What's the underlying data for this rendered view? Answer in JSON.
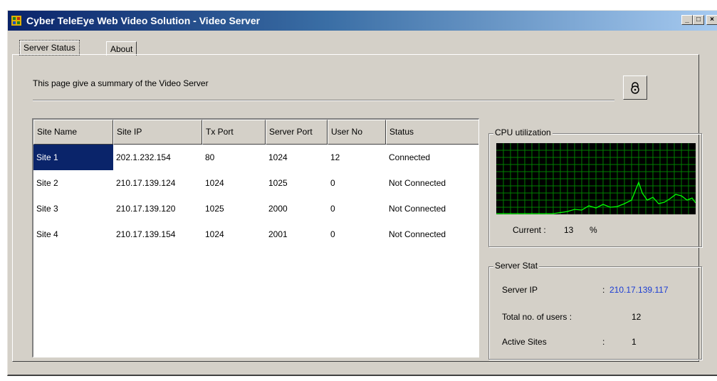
{
  "window": {
    "title": "Cyber TeleEye Web Video Solution - Video Server",
    "accent_color": "#0a246a"
  },
  "tabs": [
    {
      "label": "Server Status",
      "active": true
    },
    {
      "label": "About",
      "active": false
    }
  ],
  "summary": {
    "text": "This page give a summary of the Video Server",
    "lock_icon": "lock-icon"
  },
  "table": {
    "columns": [
      "Site Name",
      "Site IP",
      "Tx Port",
      "Server Port",
      "User No",
      "Status"
    ],
    "rows": [
      [
        "Site 1",
        "202.1.232.154",
        "80",
        "1024",
        "12",
        "Connected"
      ],
      [
        "Site 2",
        "210.17.139.124",
        "1024",
        "1025",
        "0",
        "Not Connected"
      ],
      [
        "Site 3",
        "210.17.139.120",
        "1025",
        "2000",
        "0",
        "Not Connected"
      ],
      [
        "Site 4",
        "210.17.139.154",
        "1024",
        "2001",
        "0",
        "Not Connected"
      ]
    ],
    "selected_row": 0
  },
  "cpu": {
    "title": "CPU utilization",
    "current_label": "Current :",
    "current_value": "13",
    "current_unit": "%",
    "graph_color": "#00ff00",
    "grid_color": "#008000"
  },
  "server_stat": {
    "title": "Server Stat",
    "server_ip_label": "Server IP",
    "server_ip_value": "210.17.139.117",
    "server_ip_color": "#1a3cd4",
    "total_users_label": "Total no. of users :",
    "total_users_value": "12",
    "active_sites_label": "Active Sites",
    "active_sites_value": "1"
  }
}
